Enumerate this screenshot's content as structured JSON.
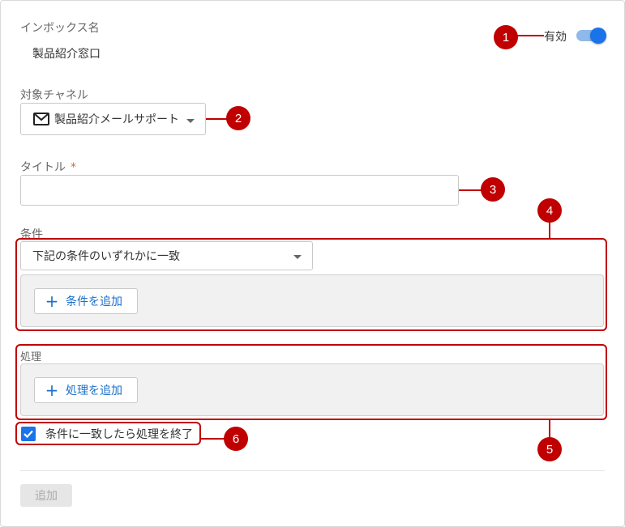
{
  "colors": {
    "accent": "#1a73e8",
    "callout": "#c00000",
    "required_mark": "#e8612c"
  },
  "inbox": {
    "label": "インボックス名",
    "value": "製品紹介窓口"
  },
  "enabled": {
    "label": "有効",
    "on": true
  },
  "channel": {
    "label": "対象チャネル",
    "icon": "mail-icon",
    "selected": "製品紹介メールサポート"
  },
  "title_field": {
    "label": "タイトル",
    "required_mark": "*",
    "value": ""
  },
  "conditions": {
    "label": "条件",
    "match_selected": "下記の条件のいずれかに一致",
    "add_label": "条件を追加"
  },
  "actions": {
    "label": "処理",
    "add_label": "処理を追加"
  },
  "stop_processing": {
    "label": "条件に一致したら処理を終了",
    "checked": true
  },
  "submit": {
    "label": "追加"
  },
  "callouts": [
    "1",
    "2",
    "3",
    "4",
    "5",
    "6"
  ]
}
